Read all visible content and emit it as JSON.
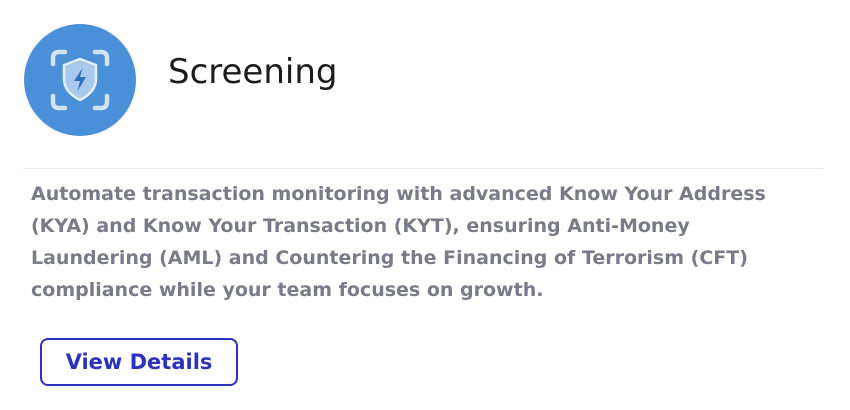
{
  "card": {
    "icon": "shield-lightning-scan-icon",
    "title": "Screening",
    "description": "Automate transaction monitoring with advanced Know Your Address (KYA) and Know Your Transaction (KYT), ensuring Anti-Money Laundering (AML) and Countering the Financing of Terrorism (CFT) compliance while your team focuses on growth.",
    "button_label": "View Details"
  },
  "colors": {
    "icon_background": "#4a90d9",
    "title_text": "#1c1c1c",
    "description_text": "#7a7b8a",
    "button_accent": "#2c32c0",
    "divider": "#e6e6e6"
  }
}
